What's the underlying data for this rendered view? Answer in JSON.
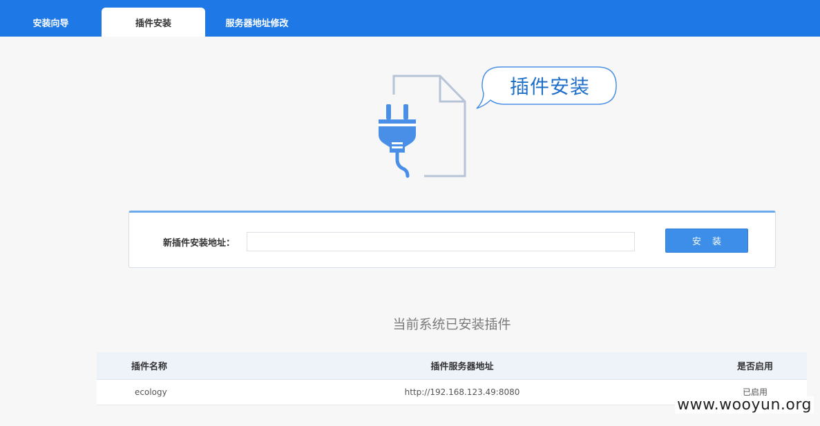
{
  "tabs": [
    {
      "label": "安装向导",
      "active": false
    },
    {
      "label": "插件安装",
      "active": true
    },
    {
      "label": "服务器地址修改",
      "active": false
    }
  ],
  "hero": {
    "bubble_text": "插件安装",
    "icons": [
      "plug-icon",
      "document-icon",
      "speech-bubble-icon"
    ]
  },
  "install": {
    "label": "新插件安装地址：",
    "input_value": "",
    "input_placeholder": "",
    "button_label": "安 装"
  },
  "installed": {
    "title": "当前系统已安装插件",
    "columns": [
      "插件名称",
      "插件服务器地址",
      "是否启用"
    ],
    "rows": [
      {
        "name": "ecology",
        "url": "http://192.168.123.49:8080",
        "status": "已启用"
      }
    ]
  },
  "watermark": "www.wooyun.org",
  "colors": {
    "topbar": "#1e78e6",
    "accent": "#3d8ee8",
    "status_enabled": "#3aa53a",
    "icon_blue": "#4a8fe7",
    "icon_outline": "#b7c3d6"
  }
}
